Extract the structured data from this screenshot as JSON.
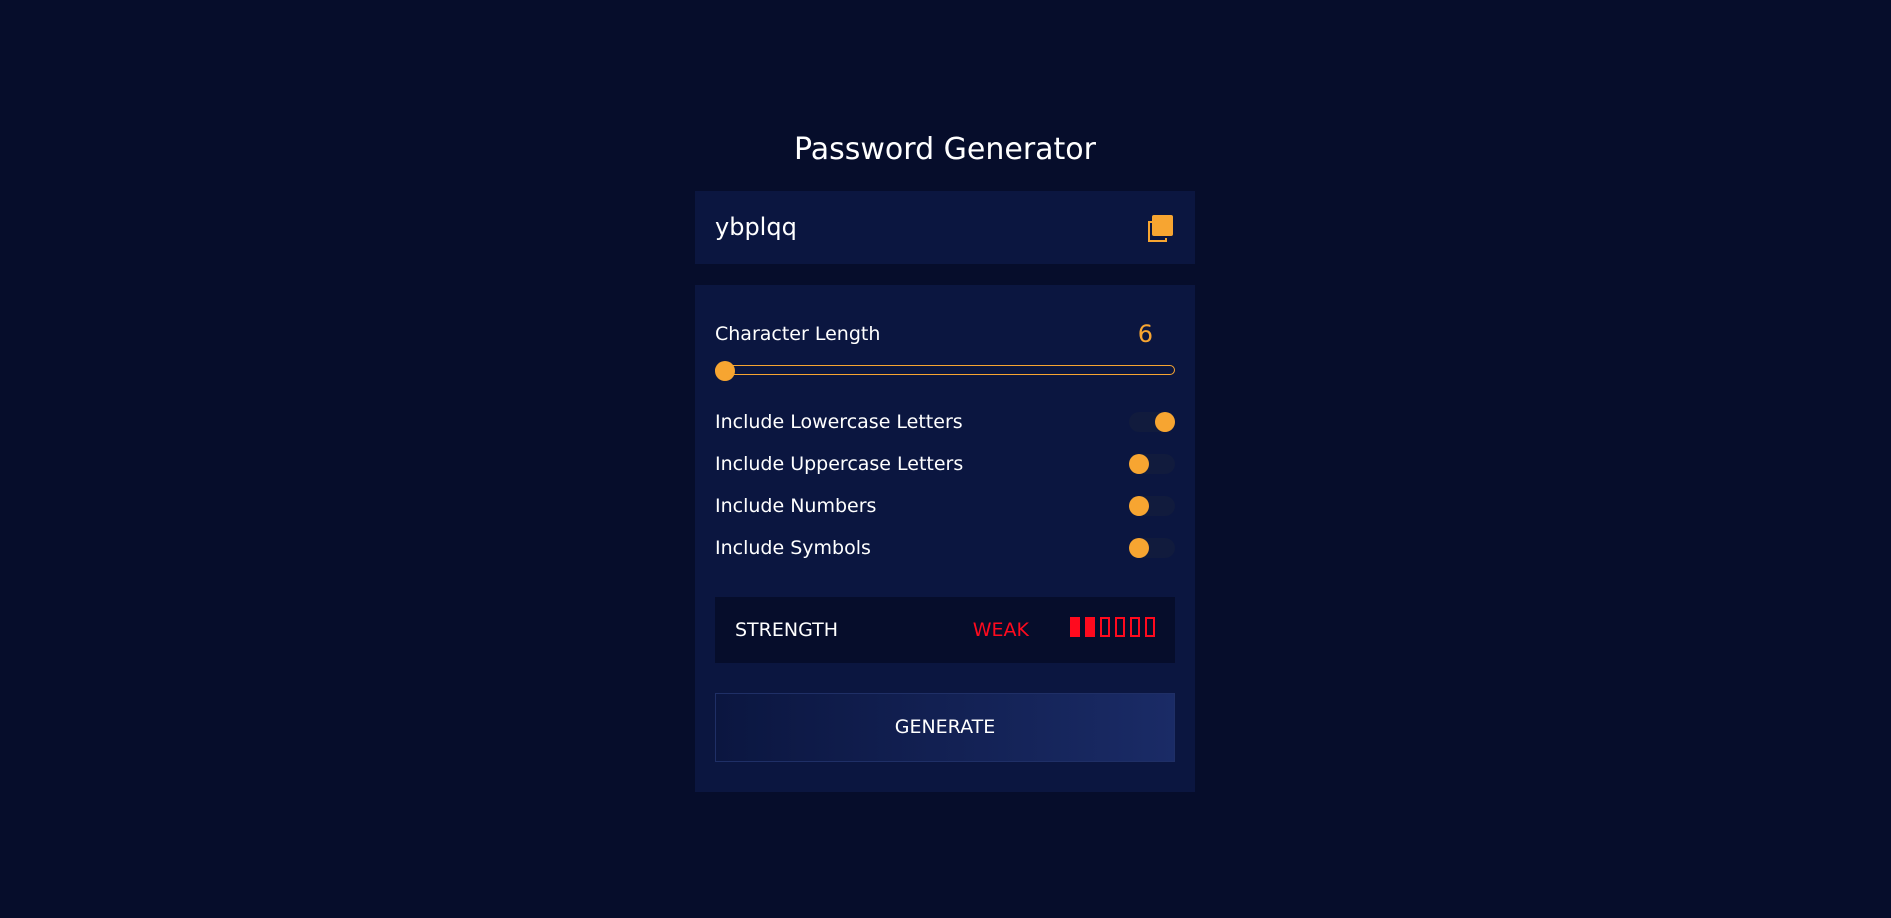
{
  "app": {
    "title": "Password Generator"
  },
  "output": {
    "password": "ybplqq",
    "copy_icon": "copy-icon"
  },
  "length": {
    "label": "Character Length",
    "value": "6",
    "slider_fraction": 0.0
  },
  "options": [
    {
      "label": "Include Lowercase Letters",
      "checked": true
    },
    {
      "label": "Include Uppercase Letters",
      "checked": false
    },
    {
      "label": "Include Numbers",
      "checked": false
    },
    {
      "label": "Include Symbols",
      "checked": false
    }
  ],
  "strength": {
    "label": "STRENGTH",
    "value": "WEAK",
    "filled_bars": 2,
    "total_bars": 6
  },
  "generate": {
    "label": "GENERATE"
  },
  "colors": {
    "background": "#060d2b",
    "panel": "#0b1640",
    "accent": "#f7a531",
    "weak": "#ff0a1e",
    "text": "#ffffff"
  }
}
